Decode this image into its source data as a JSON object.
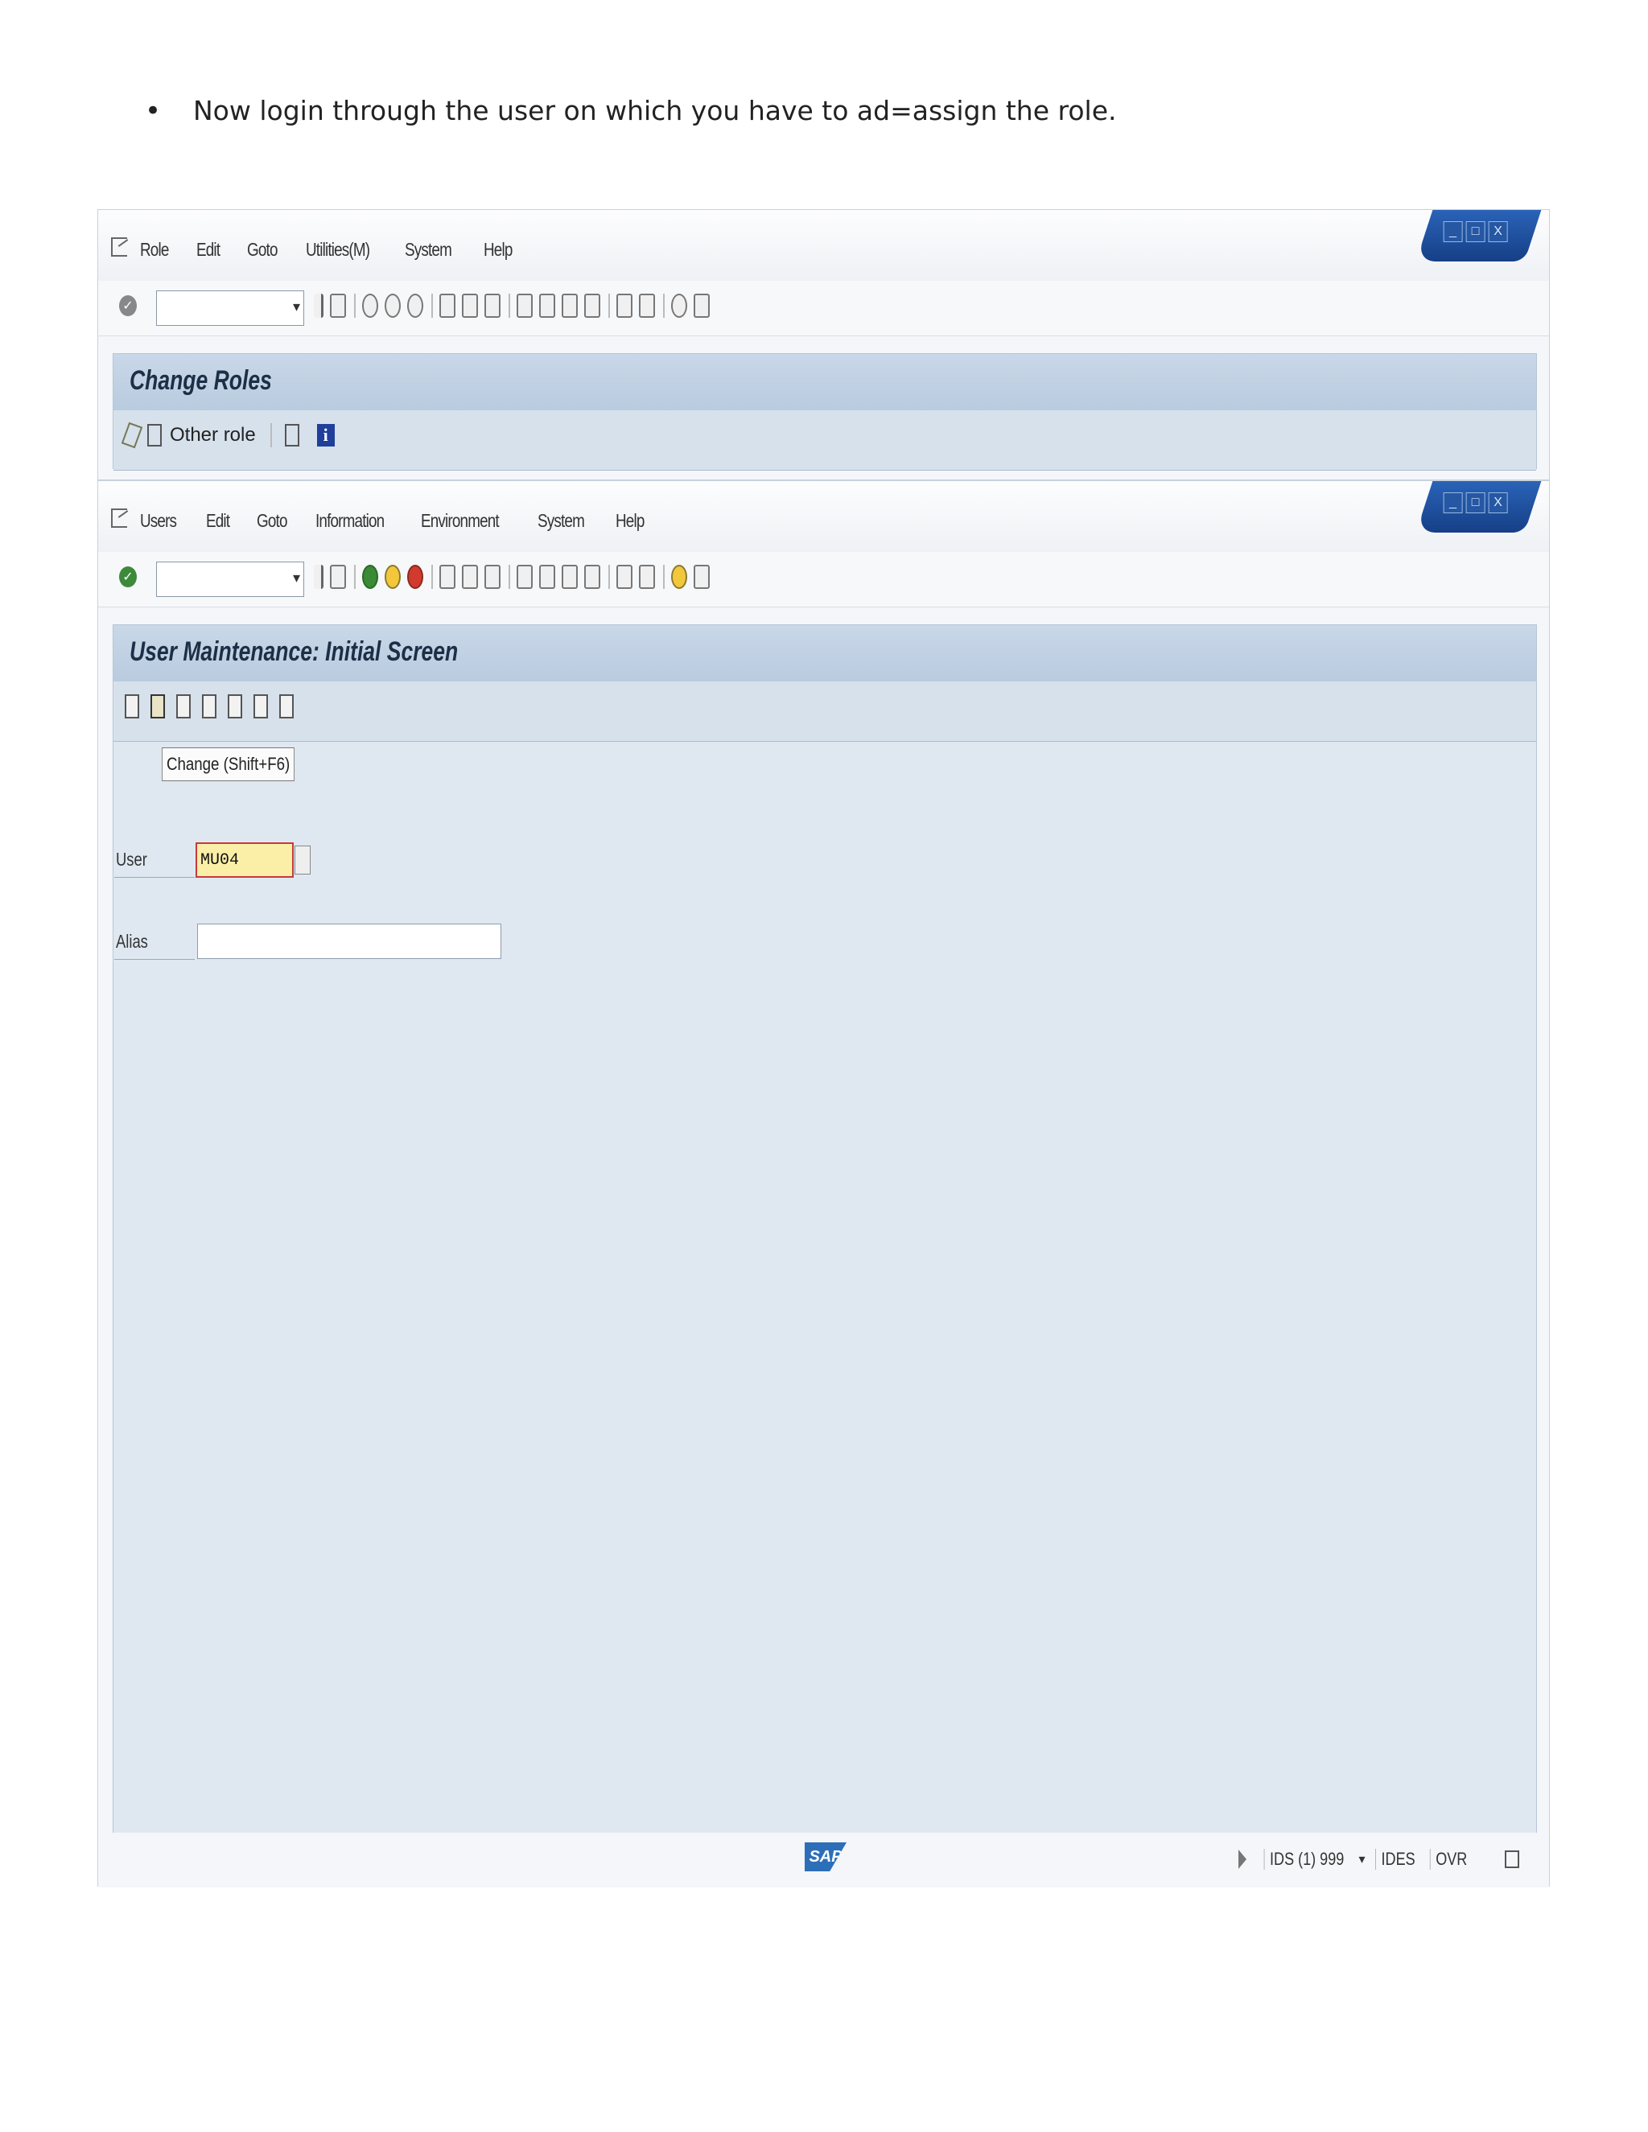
{
  "doc": {
    "bullet": "•",
    "text": "Now login through the user on which you have to ad=assign the role."
  },
  "window1": {
    "menu": [
      "Role",
      "Edit",
      "Goto",
      "Utilities(M)",
      "System",
      "Help"
    ],
    "title": "Change Roles",
    "app_toolbar": {
      "other_role_label": "Other role",
      "info_icon": "i"
    },
    "window_controls": [
      "_",
      "□",
      "X"
    ]
  },
  "window2": {
    "menu": [
      "Users",
      "Edit",
      "Goto",
      "Information",
      "Environment",
      "System",
      "Help"
    ],
    "title": "User Maintenance: Initial Screen",
    "tooltip": "Change   (Shift+F6)",
    "fields": {
      "user_label": "User",
      "user_value": "MU04",
      "alias_label": "Alias",
      "alias_value": ""
    },
    "window_controls": [
      "_",
      "□",
      "X"
    ]
  },
  "statusbar": {
    "logo": "SAP",
    "system": "IDS (1) 999",
    "dropdown_marker": "▾",
    "server": "IDES",
    "mode": "OVR"
  },
  "colors": {
    "panel_bg": "#dfe8f1",
    "title_bg": "#c9d8e8",
    "window_control_blue": "#2a63b8",
    "focus_field_bg": "#fbefa8"
  }
}
